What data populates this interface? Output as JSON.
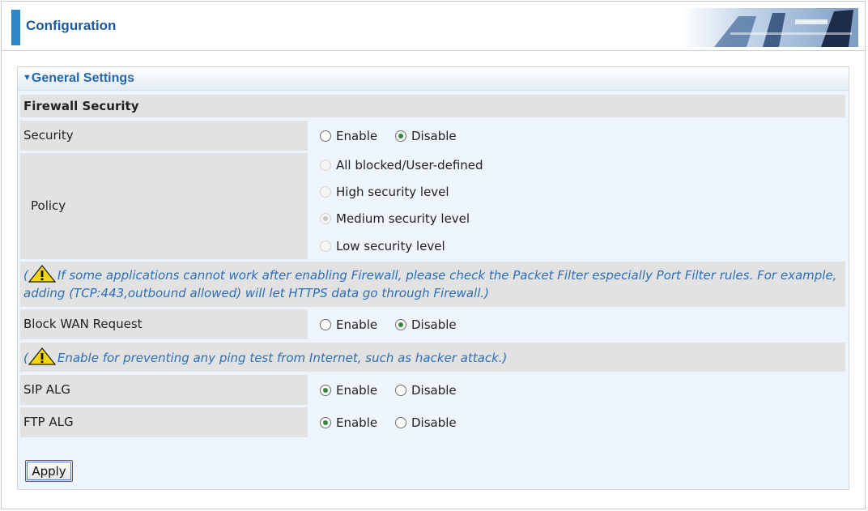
{
  "header": {
    "title": "Configuration"
  },
  "panel": {
    "title": "General Settings"
  },
  "section": {
    "title": "Firewall Security"
  },
  "security": {
    "label": "Security",
    "enable_label": "Enable",
    "disable_label": "Disable",
    "selected": "Disable"
  },
  "policy": {
    "label": "Policy",
    "options": [
      "All blocked/User-defined",
      "High security level",
      "Medium security level",
      "Low security level"
    ],
    "selected": "Medium security level",
    "disabled": true
  },
  "notes": {
    "firewall": "If some applications cannot work after enabling Firewall, please check the Packet Filter especially Port Filter rules. For example, adding (TCP:443,outbound allowed) will let HTTPS data go through Firewall.)",
    "ping": "Enable for preventing any ping test from Internet, such as hacker attack.)",
    "paren_open": "("
  },
  "block_wan": {
    "label": "Block WAN Request",
    "enable_label": "Enable",
    "disable_label": "Disable",
    "selected": "Disable"
  },
  "sip_alg": {
    "label": "SIP ALG",
    "enable_label": "Enable",
    "disable_label": "Disable",
    "selected": "Enable"
  },
  "ftp_alg": {
    "label": "FTP ALG",
    "enable_label": "Enable",
    "disable_label": "Disable",
    "selected": "Enable"
  },
  "apply_label": "Apply",
  "colors": {
    "accent": "#2d86c6",
    "title_text": "#1c5a99",
    "note_text": "#2b6fb5",
    "radio_on": "#2f8a3a"
  }
}
